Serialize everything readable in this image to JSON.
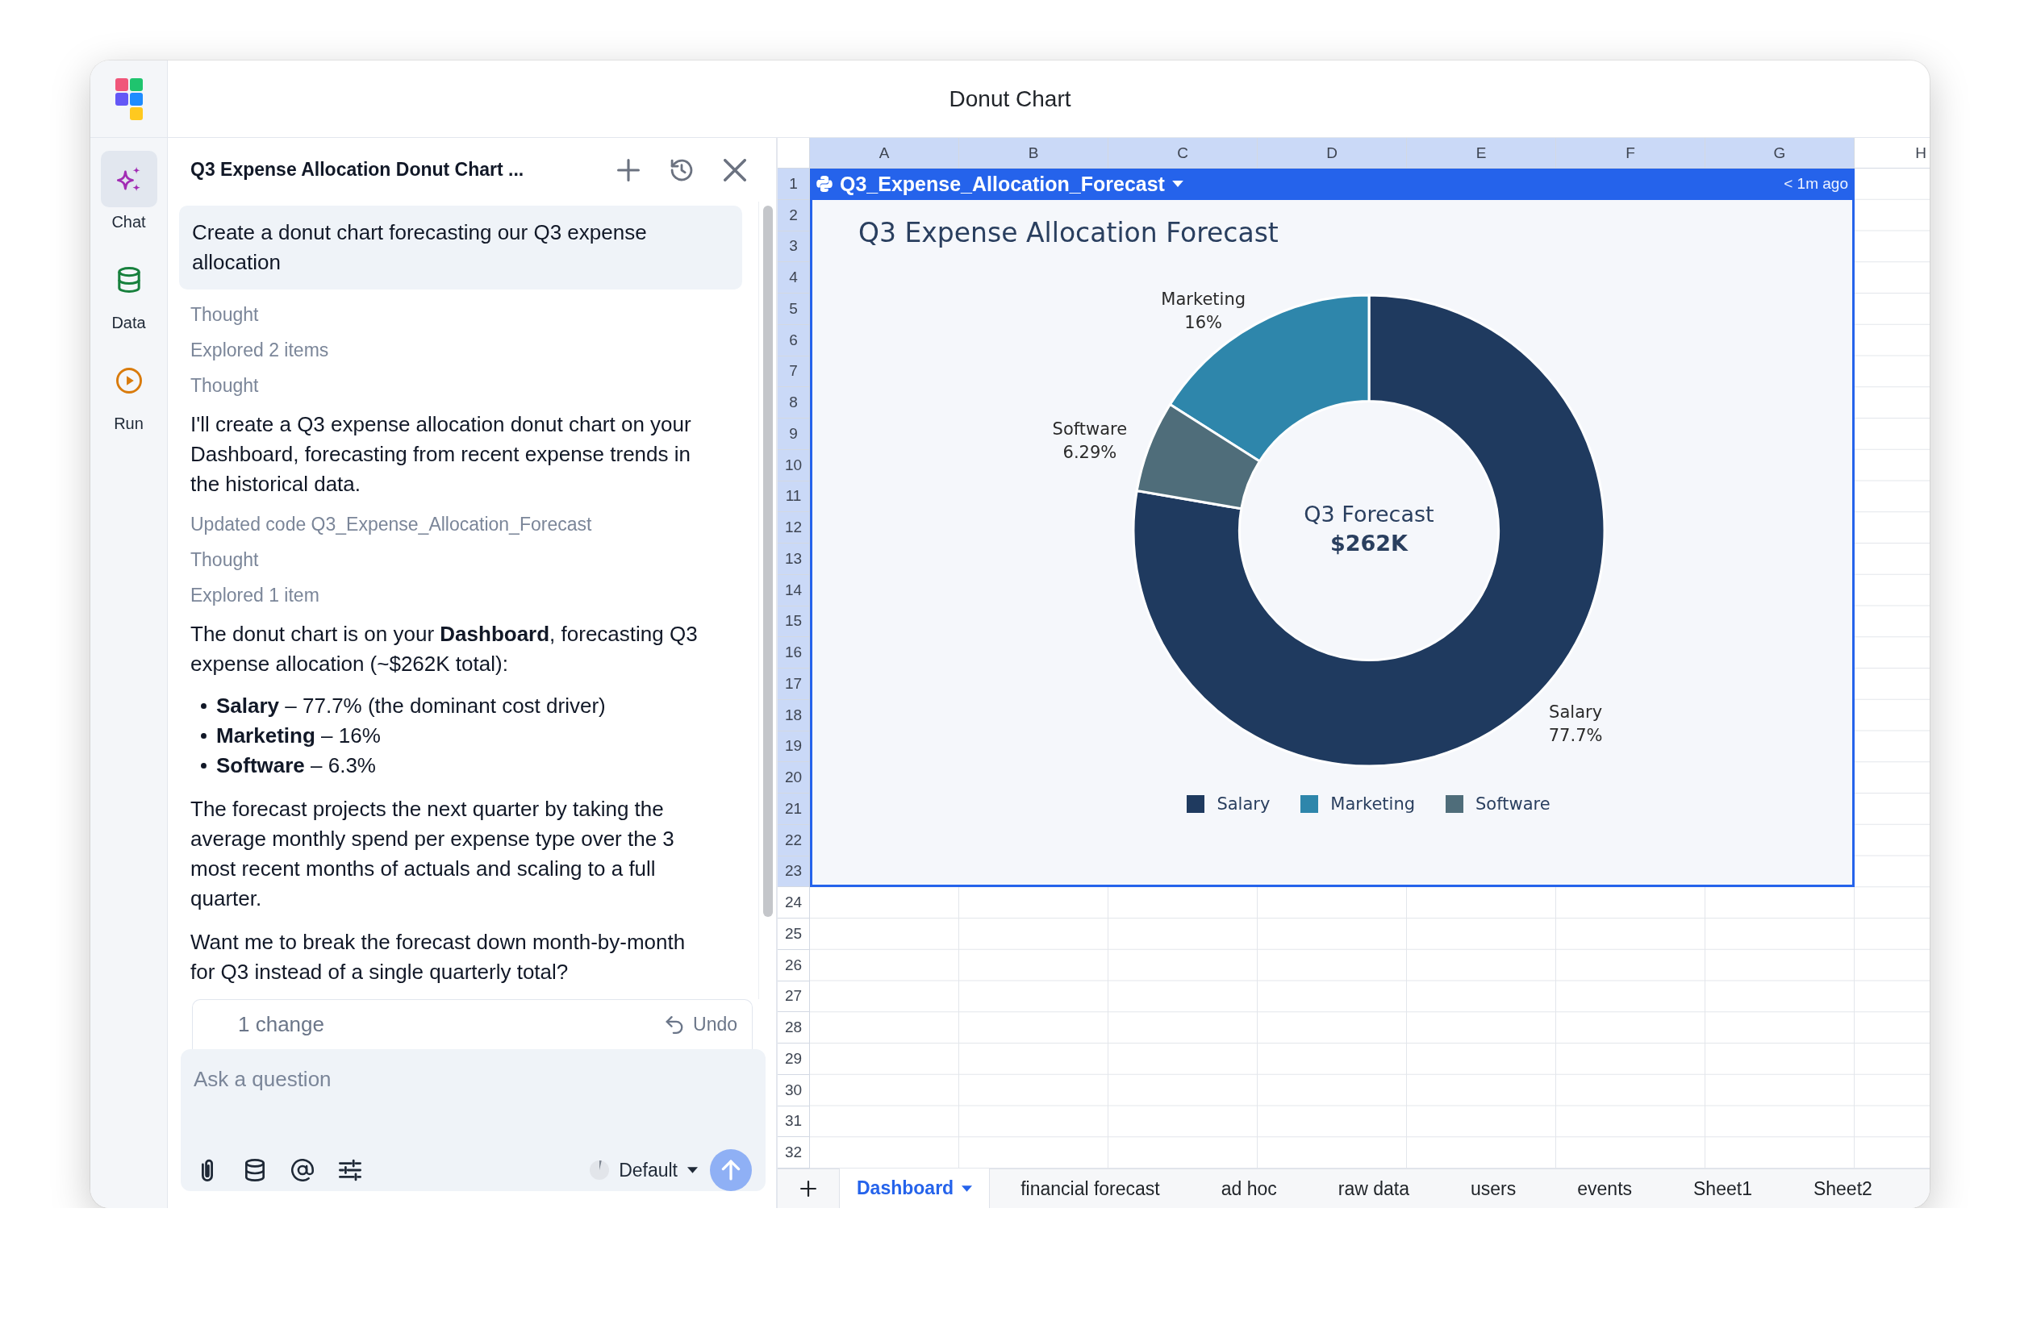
{
  "window": {
    "title": "Donut Chart"
  },
  "rail": {
    "items": [
      {
        "label": "Chat",
        "selected": true
      },
      {
        "label": "Data",
        "selected": false
      },
      {
        "label": "Run",
        "selected": false
      }
    ]
  },
  "chat": {
    "title": "Q3 Expense Allocation Donut Chart ...",
    "messages": [
      {
        "kind": "user",
        "text": "Create a donut chart forecasting our Q3 expense allocation"
      },
      {
        "kind": "step",
        "text": "Thought"
      },
      {
        "kind": "step",
        "text": "Explored 2 items"
      },
      {
        "kind": "step",
        "text": "Thought"
      },
      {
        "kind": "text",
        "text": "I'll create a Q3 expense allocation donut chart on your Dashboard, forecasting from recent expense trends in the historical data."
      },
      {
        "kind": "step",
        "text": "Updated code Q3_Expense_Allocation_Forecast"
      },
      {
        "kind": "step",
        "text": "Thought"
      },
      {
        "kind": "step",
        "text": "Explored 1 item"
      },
      {
        "kind": "text",
        "text": "The donut chart is on your **Dashboard**, forecasting Q3 expense allocation (~$262K total):"
      },
      {
        "kind": "list",
        "items": [
          "**Salary** – 77.7% (the dominant cost driver)",
          "**Marketing** – 16%",
          "**Software** – 6.3%"
        ]
      },
      {
        "kind": "text",
        "text": "The forecast projects the next quarter by taking the average monthly spend per expense type over the 3 most recent months of actuals and scaling to a full quarter."
      },
      {
        "kind": "text",
        "text": "Want me to break the forecast down month-by-month for Q3 instead of a single quarterly total?"
      }
    ],
    "changes": {
      "label": "1 change",
      "action": "Undo"
    },
    "composer": {
      "placeholder": "Ask a question",
      "mode": "Default",
      "send_disabled": true
    }
  },
  "sheet": {
    "columns": [
      {
        "label": "A",
        "selected": true
      },
      {
        "label": "B",
        "selected": true
      },
      {
        "label": "C",
        "selected": true
      },
      {
        "label": "D",
        "selected": true
      },
      {
        "label": "E",
        "selected": true
      },
      {
        "label": "F",
        "selected": true
      },
      {
        "label": "G",
        "selected": true
      },
      {
        "label": "H",
        "selected": false
      }
    ],
    "rows": [
      {
        "label": "1",
        "selected": true
      },
      {
        "label": "2",
        "selected": true
      },
      {
        "label": "3",
        "selected": true
      },
      {
        "label": "4",
        "selected": true
      },
      {
        "label": "5",
        "selected": true
      },
      {
        "label": "6",
        "selected": true
      },
      {
        "label": "7",
        "selected": true
      },
      {
        "label": "8",
        "selected": true
      },
      {
        "label": "9",
        "selected": true
      },
      {
        "label": "10",
        "selected": true
      },
      {
        "label": "11",
        "selected": true
      },
      {
        "label": "12",
        "selected": true
      },
      {
        "label": "13",
        "selected": true
      },
      {
        "label": "14",
        "selected": true
      },
      {
        "label": "15",
        "selected": true
      },
      {
        "label": "16",
        "selected": true
      },
      {
        "label": "17",
        "selected": true
      },
      {
        "label": "18",
        "selected": true
      },
      {
        "label": "19",
        "selected": true
      },
      {
        "label": "20",
        "selected": true
      },
      {
        "label": "21",
        "selected": true
      },
      {
        "label": "22",
        "selected": true
      },
      {
        "label": "23",
        "selected": true
      },
      {
        "label": "24",
        "selected": false
      },
      {
        "label": "25",
        "selected": false
      },
      {
        "label": "26",
        "selected": false
      },
      {
        "label": "27",
        "selected": false
      },
      {
        "label": "28",
        "selected": false
      },
      {
        "label": "29",
        "selected": false
      },
      {
        "label": "30",
        "selected": false
      },
      {
        "label": "31",
        "selected": false
      },
      {
        "label": "32",
        "selected": false
      }
    ],
    "embed": {
      "name": "Q3_Expense_Allocation_Forecast",
      "updated": "< 1m ago",
      "center_label": "Q3 Forecast",
      "center_value": "$262K",
      "chart_data": {
        "type": "donut",
        "title": "Q3 Expense Allocation Forecast",
        "categories": [
          "Salary",
          "Marketing",
          "Software"
        ],
        "values": [
          77.7,
          16,
          6.29
        ],
        "value_labels": [
          "77.7%",
          "16%",
          "6.29%"
        ]
      },
      "legend": [
        {
          "label": "Salary",
          "color": "#1f3a5f"
        },
        {
          "label": "Marketing",
          "color": "#2e86ab"
        },
        {
          "label": "Software",
          "color": "#4f6d7a"
        }
      ]
    },
    "tabs": [
      {
        "label": "Dashboard",
        "selected": true
      },
      {
        "label": "financial forecast",
        "selected": false
      },
      {
        "label": "ad hoc",
        "selected": false
      },
      {
        "label": "raw data",
        "selected": false
      },
      {
        "label": "users",
        "selected": false
      },
      {
        "label": "events",
        "selected": false
      },
      {
        "label": "Sheet1",
        "selected": false
      },
      {
        "label": "Sheet2",
        "selected": false
      }
    ]
  }
}
